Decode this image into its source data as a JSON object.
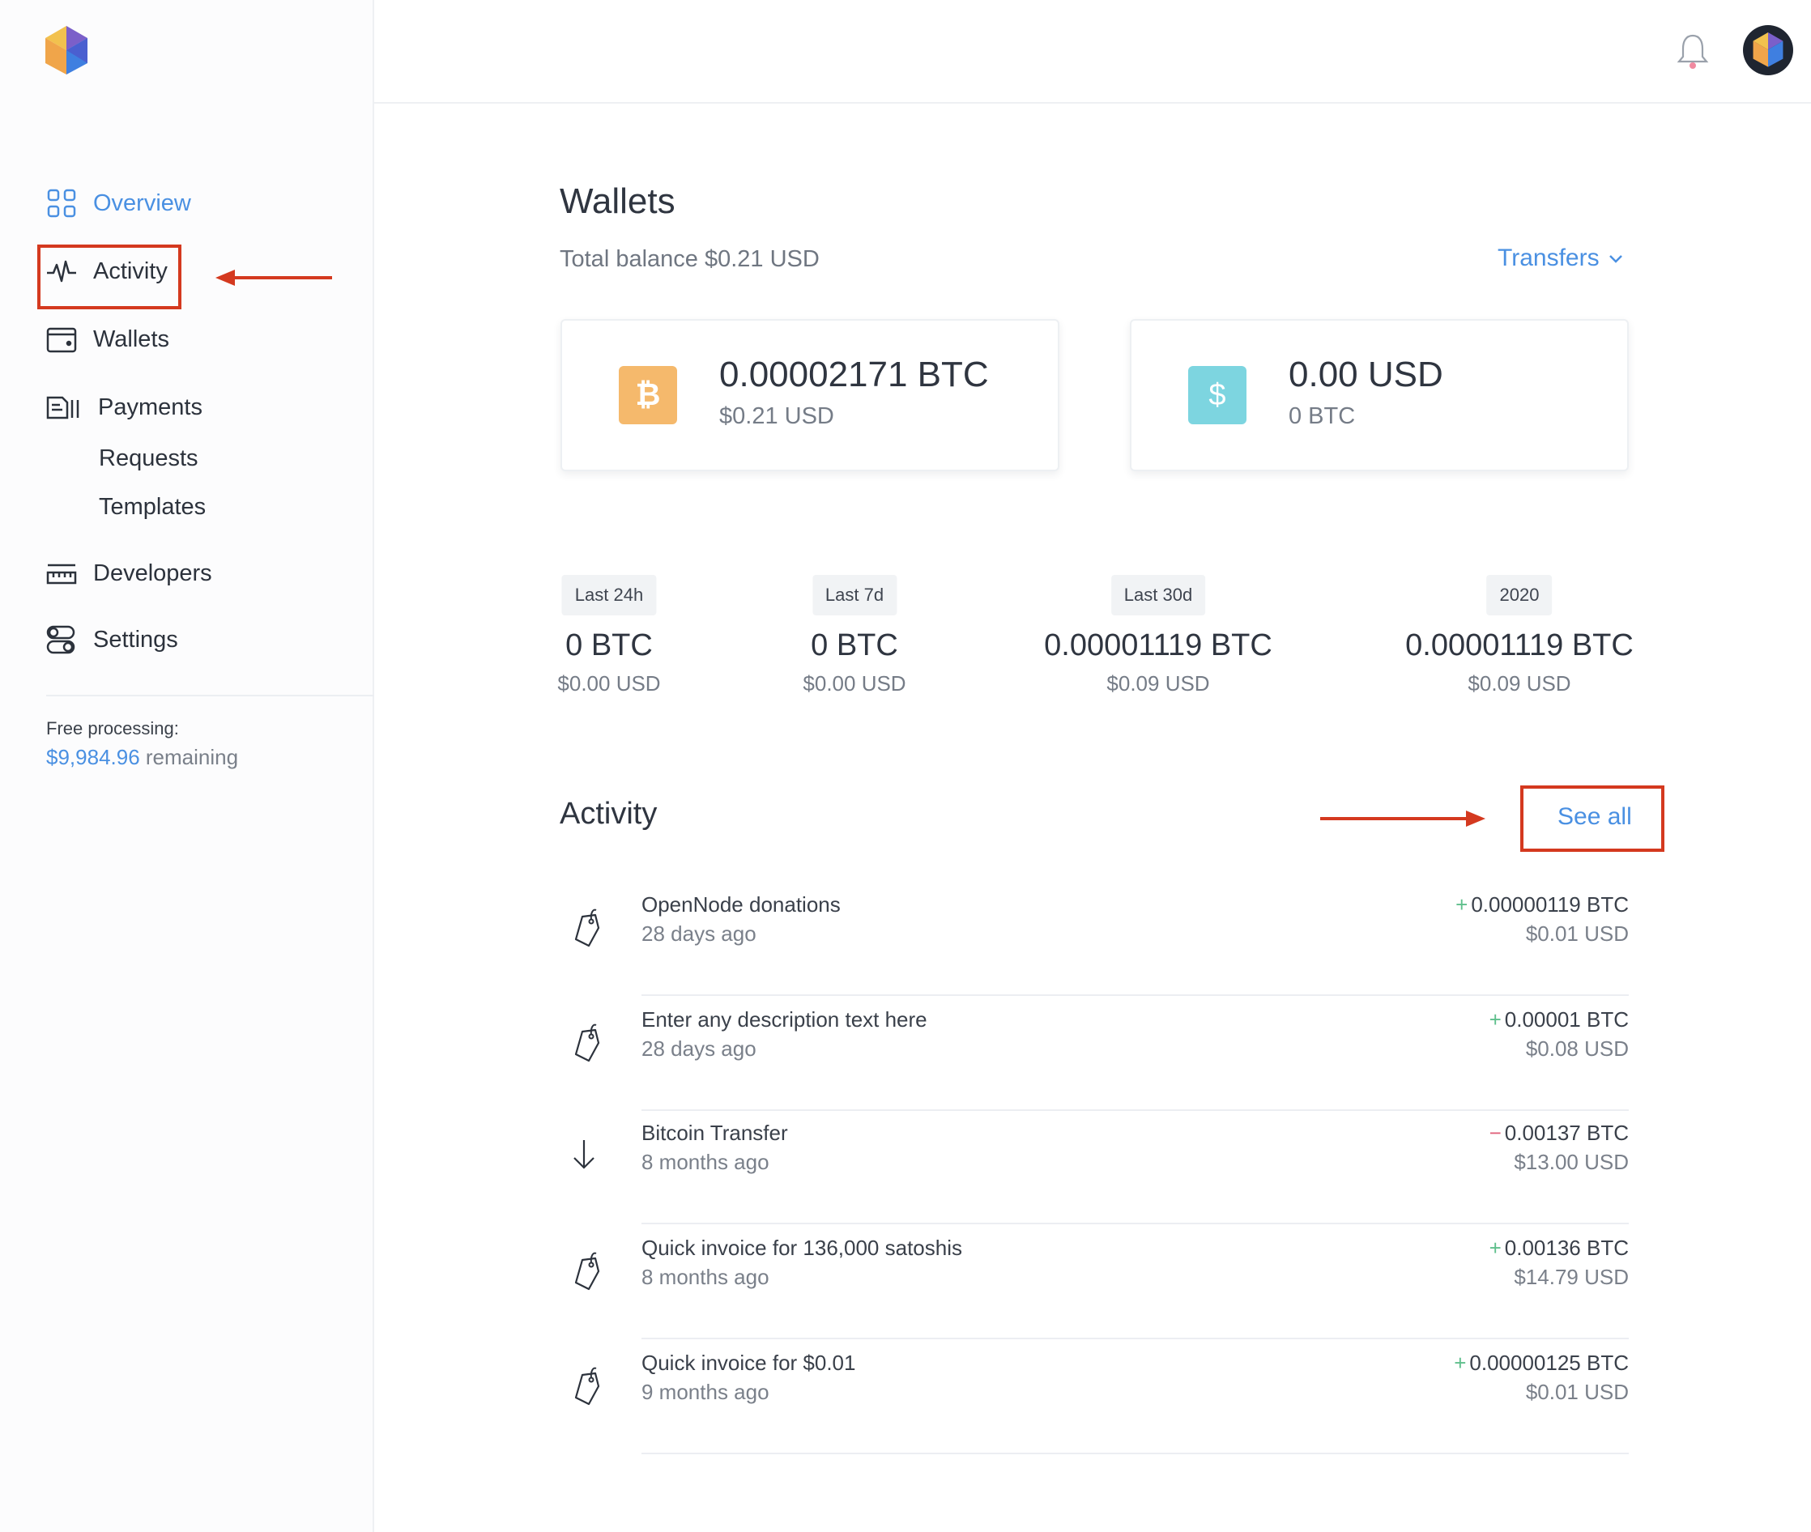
{
  "sidebar": {
    "nav": [
      {
        "label": "Overview",
        "icon": "grid-icon",
        "active": true
      },
      {
        "label": "Activity",
        "icon": "pulse-icon"
      },
      {
        "label": "Wallets",
        "icon": "wallet-icon"
      },
      {
        "label": "Payments",
        "icon": "payments-icon"
      },
      {
        "label": "Requests"
      },
      {
        "label": "Templates"
      },
      {
        "label": "Developers",
        "icon": "ruler-icon"
      },
      {
        "label": "Settings",
        "icon": "toggles-icon"
      }
    ],
    "free_processing_label": "Free processing:",
    "free_amount": "$9,984.96",
    "free_remaining": " remaining"
  },
  "header": {
    "bell_icon": "bell-icon",
    "avatar": "user-avatar"
  },
  "main": {
    "title": "Wallets",
    "total_balance": "Total balance $0.21 USD",
    "transfers_label": "Transfers",
    "wallets": [
      {
        "amount": "0.00002171 BTC",
        "sub": "$0.21 USD",
        "symbol": "₿",
        "icon": "bitcoin-icon",
        "color": "#f5b96c"
      },
      {
        "amount": "0.00 USD",
        "sub": "0 BTC",
        "symbol": "$",
        "icon": "dollar-icon",
        "color": "#7dd5e0"
      }
    ],
    "periods": [
      {
        "label": "Last 24h",
        "value": "0 BTC",
        "usd": "$0.00 USD"
      },
      {
        "label": "Last 7d",
        "value": "0 BTC",
        "usd": "$0.00 USD"
      },
      {
        "label": "Last 30d",
        "value": "0.00001119 BTC",
        "usd": "$0.09 USD"
      },
      {
        "label": "2020",
        "value": "0.00001119 BTC",
        "usd": "$0.09 USD"
      }
    ],
    "activity_title": "Activity",
    "see_all": "See all",
    "transactions": [
      {
        "desc": "OpenNode donations",
        "time": "28 days ago",
        "sign": "+",
        "amount": "0.00000119 BTC",
        "usd": "$0.01 USD",
        "icon": "tag-icon"
      },
      {
        "desc": "Enter any description text here",
        "time": "28 days ago",
        "sign": "+",
        "amount": "0.00001 BTC",
        "usd": "$0.08 USD",
        "icon": "tag-icon"
      },
      {
        "desc": "Bitcoin Transfer",
        "time": "8 months ago",
        "sign": "−",
        "amount": "0.00137 BTC",
        "usd": "$13.00 USD",
        "icon": "arrow-down-icon"
      },
      {
        "desc": "Quick invoice for 136,000 satoshis",
        "time": "8 months ago",
        "sign": "+",
        "amount": "0.00136 BTC",
        "usd": "$14.79 USD",
        "icon": "tag-icon"
      },
      {
        "desc": "Quick invoice for $0.01",
        "time": "9 months ago",
        "sign": "+",
        "amount": "0.00000125 BTC",
        "usd": "$0.01 USD",
        "icon": "tag-icon"
      }
    ]
  },
  "colors": {
    "accent": "#4a90e2",
    "annotation": "#d4391f",
    "positive": "#5fbf8c",
    "negative": "#e0607a"
  }
}
